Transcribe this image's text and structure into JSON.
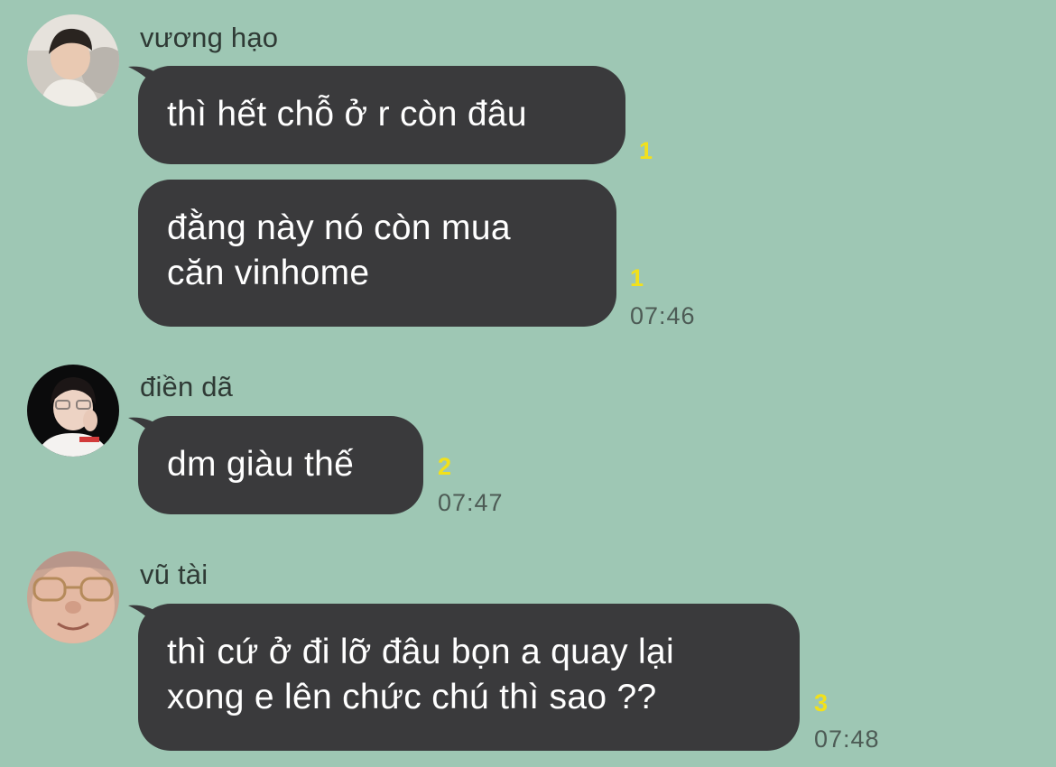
{
  "messages": [
    {
      "sender": "vương hạo",
      "avatar": "photo-avatar-boy-light",
      "bubbles": [
        {
          "lines": [
            "thì hết chỗ ở r còn đâu"
          ],
          "read_count": "1",
          "time": ""
        },
        {
          "lines": [
            "đằng này nó còn mua",
            "căn vinhome"
          ],
          "read_count": "1",
          "time": "07:46"
        }
      ]
    },
    {
      "sender": "điền dã",
      "avatar": "photo-avatar-boy-dark",
      "bubbles": [
        {
          "lines": [
            "dm giàu thế"
          ],
          "read_count": "2",
          "time": "07:47"
        }
      ]
    },
    {
      "sender": "vũ tài",
      "avatar": "photo-avatar-glasses",
      "bubbles": [
        {
          "lines": [
            "thì cứ ở đi lỡ đâu bọn a quay lại",
            "xong e lên chức chú thì sao ??"
          ],
          "read_count": "3",
          "time": "07:48"
        }
      ]
    }
  ],
  "colors": {
    "background": "#9ec7b4",
    "bubble": "#3a3a3c",
    "bubble_text": "#ffffff",
    "read_count": "#f2e11b",
    "time": "#4d5b55"
  }
}
